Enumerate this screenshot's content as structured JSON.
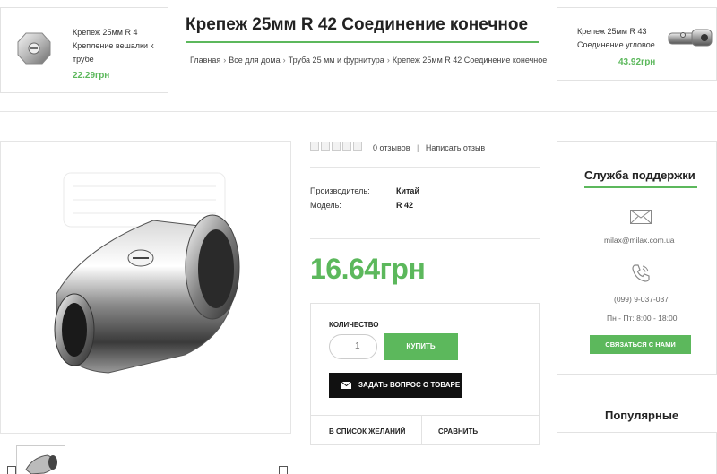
{
  "prev_product": {
    "name_line1": "Крепеж 25мм R 4",
    "name_line2": "Крепление вешалки к",
    "name_line3": "трубе",
    "price": "22.29грн"
  },
  "next_product": {
    "name_line1": "Крепеж 25мм R 43",
    "name_line2": "Соединение угловое",
    "price": "43.92грн"
  },
  "page_title": "Крепеж 25мм R 42 Соединение конечное",
  "breadcrumbs": [
    "Главная",
    "Все для дома",
    "Труба 25 мм и фурнитура",
    "Крепеж 25мм R 42 Соединение конечное"
  ],
  "breadcrumb_separator": "›",
  "reviews": {
    "count_text": "0 отзывов",
    "divider": "|",
    "write_text": "Написать отзыв"
  },
  "specs": {
    "manufacturer_label": "Производитель:",
    "manufacturer_value": "Китай",
    "model_label": "Модель:",
    "model_value": "R 42"
  },
  "price": "16.64грн",
  "purchase": {
    "qty_label": "КОЛИЧЕСТВО",
    "qty_value": "1",
    "buy_label": "КУПИТЬ",
    "ask_label": "ЗАДАТЬ ВОПРОС О ТОВАРЕ",
    "wishlist_label": "В СПИСОК ЖЕЛАНИЙ",
    "compare_label": "СРАВНИТЬ"
  },
  "support": {
    "title": "Служба поддержки",
    "email": "milax@milax.com.ua",
    "phone": "(099) 9-037-037",
    "hours": "Пн - Пт: 8:00 - 18:00",
    "contact_button": "СВЯЗАТЬСЯ С НАМИ"
  },
  "popular": {
    "title": "Популярные"
  },
  "colors": {
    "accent": "#5cb85c",
    "dark_button": "#111111",
    "border": "#e2e2e2"
  },
  "icons": [
    "mail-icon",
    "phone-icon",
    "envelope-icon",
    "star-icon"
  ]
}
